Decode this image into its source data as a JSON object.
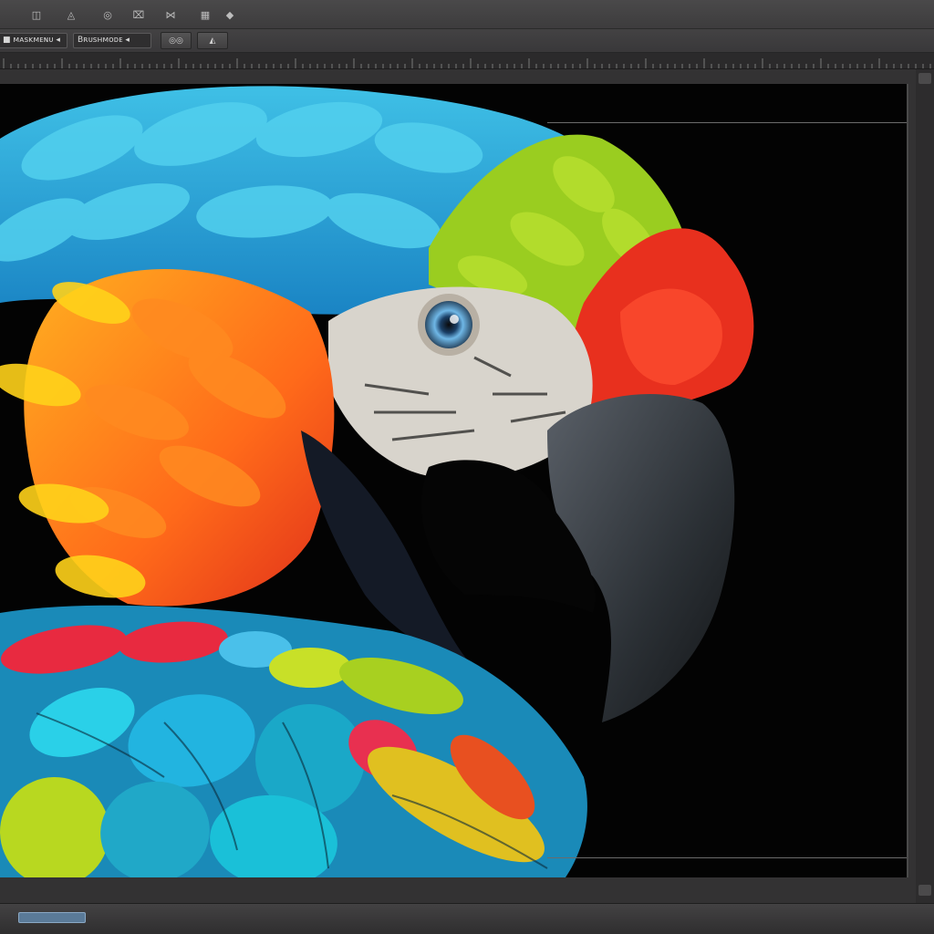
{
  "menubar": {
    "icons": [
      {
        "name": "text-tool-icon",
        "glyph": "◫"
      },
      {
        "name": "paint-tool-icon",
        "glyph": "◬"
      },
      {
        "name": "layers-icon",
        "glyph": "◎"
      },
      {
        "name": "select-tool-icon",
        "glyph": "⌧"
      },
      {
        "name": "warp-tool-icon",
        "glyph": "⋈"
      },
      {
        "name": "grid-icon",
        "glyph": "▦"
      },
      {
        "name": "diamond-icon",
        "glyph": "◆"
      }
    ]
  },
  "options": {
    "field1": "■ ᴍᴀsᴋᴍᴇɴᴜ ◂",
    "field2": "Bʀᴜsʜᴍᴏᴅᴇ ◂",
    "btn1": "◎◎",
    "btn2": "◭"
  },
  "status": {
    "field": ""
  },
  "colors": {
    "background": "#030303",
    "panel": "#3a393a",
    "accent": "#5a7a98"
  }
}
